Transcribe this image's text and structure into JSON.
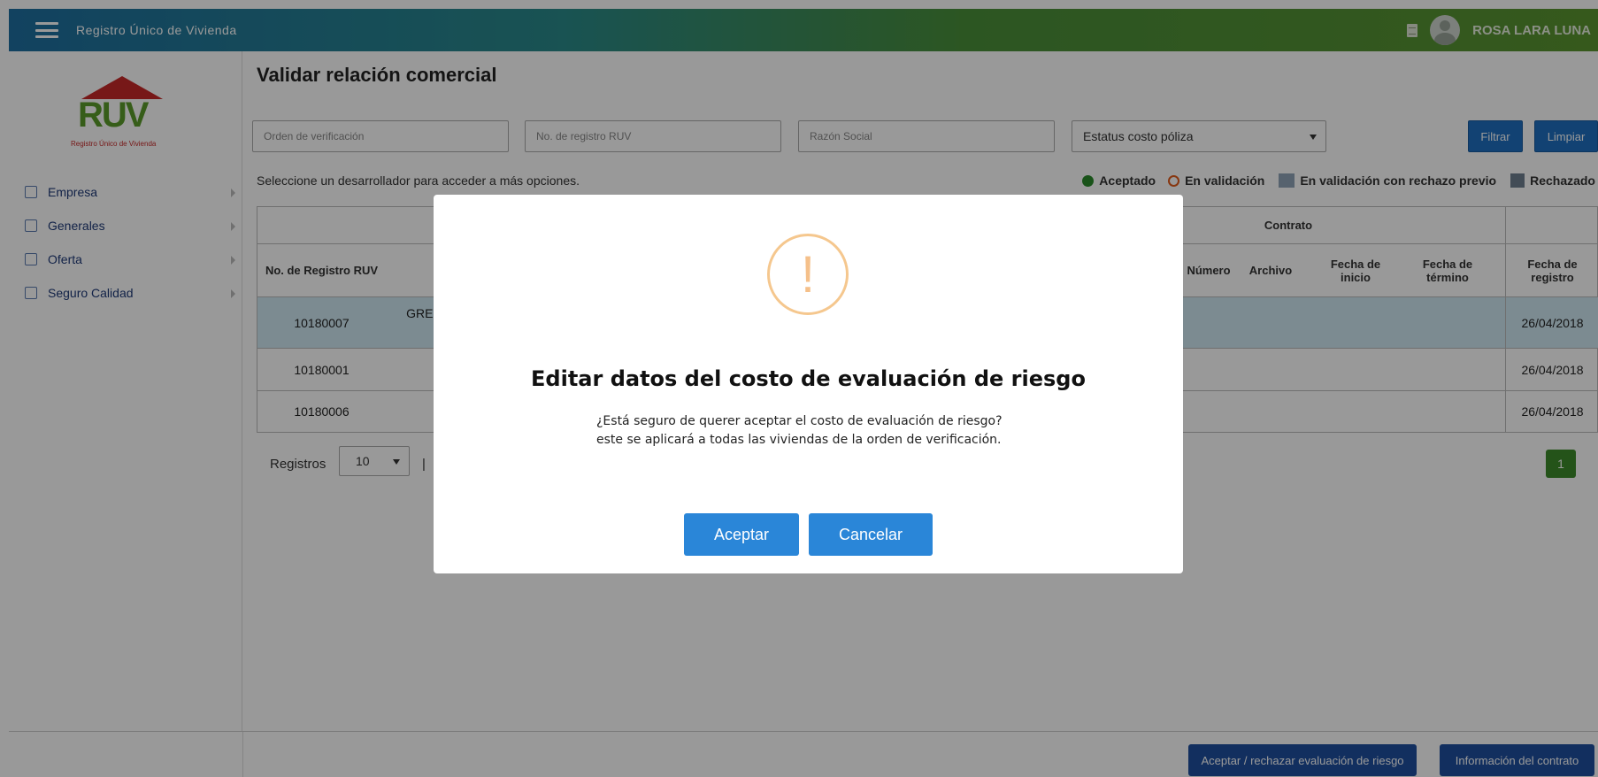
{
  "app": {
    "title": "Registro Único de Vivienda",
    "user_name": "ROSA LARA LUNA"
  },
  "logo": {
    "text": "RUV",
    "subtitle": "Registro Único de Vivienda"
  },
  "sidebar": {
    "items": [
      {
        "label": "Empresa",
        "icon": "building-icon"
      },
      {
        "label": "Generales",
        "icon": "id-card-icon"
      },
      {
        "label": "Oferta",
        "icon": "user-icon"
      },
      {
        "label": "Seguro Calidad",
        "icon": "shield-eye-icon"
      }
    ]
  },
  "main": {
    "title": "Validar relación comercial",
    "filters": {
      "orden_placeholder": "Orden de verificación",
      "registro_placeholder": "No. de registro RUV",
      "razon_placeholder": "Razón Social",
      "estatus_selected": "Estatus costo póliza",
      "filter_label": "Filtrar",
      "clear_label": "Limpiar"
    },
    "hint": "Seleccione un desarrollador para acceder a más opciones.",
    "legend": {
      "accepted": "Aceptado",
      "validating": "En validación",
      "validating_prev": "En validación con rechazo previo",
      "rejected": "Rechazado"
    },
    "table": {
      "group_header_contract": "Contrato",
      "headers": {
        "registro": "No. de Registro RUV",
        "numero": "Número",
        "archivo": "Archivo",
        "fecha_inicio": "Fecha de inicio",
        "fecha_termino": "Fecha de término",
        "fecha_registro": "Fecha de registro"
      },
      "rows": [
        {
          "registro": "10180007",
          "name": "GREE",
          "fecha_registro": "26/04/2018"
        },
        {
          "registro": "10180001",
          "name": "",
          "fecha_registro": "26/04/2018"
        },
        {
          "registro": "10180006",
          "name": "",
          "fecha_registro": "26/04/2018"
        }
      ]
    },
    "pager": {
      "label": "Registros",
      "per_page": "10",
      "separator": "|",
      "current_page": "1"
    }
  },
  "bottom": {
    "accept_reject_label": "Aceptar / rechazar evaluación de riesgo",
    "contract_info_label": "Información del contrato"
  },
  "modal": {
    "icon_glyph": "!",
    "title": "Editar datos del costo de evaluación de riesgo",
    "body_line1": "¿Está seguro de querer aceptar el costo de evaluación de riesgo?",
    "body_line2": "este se aplicará a todas las viviendas de la orden de verificación.",
    "accept_label": "Aceptar",
    "cancel_label": "Cancelar"
  }
}
